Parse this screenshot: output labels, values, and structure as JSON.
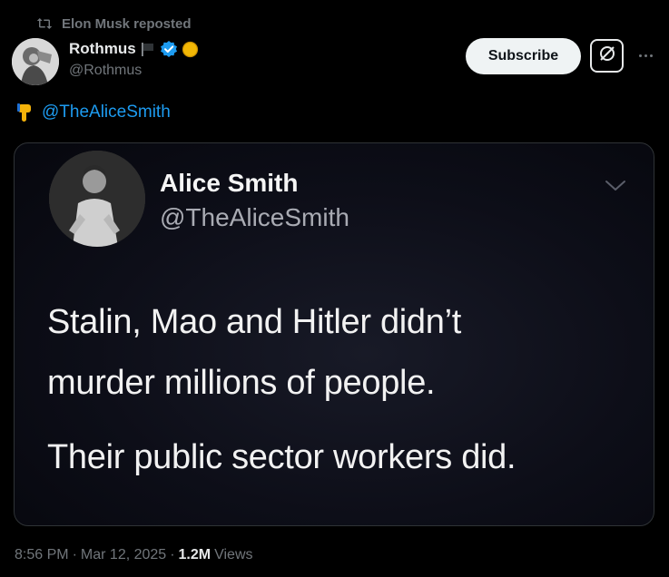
{
  "repost": {
    "label": "Elon Musk reposted",
    "icon": "repost-icon"
  },
  "author": {
    "name": "Rothmus",
    "handle": "@Rothmus",
    "avatar": "author-avatar",
    "badges": [
      "flag-emoji",
      "verified-badge",
      "gold-circle-emoji"
    ],
    "verified_color": "#1d9bf0"
  },
  "actions": {
    "subscribe_label": "Subscribe",
    "grok_icon": "grok-icon",
    "more_icon": "more-icon"
  },
  "tweet": {
    "emoji": "pointing-down-emoji",
    "mention": "@TheAliceSmith"
  },
  "media": {
    "name": "Alice Smith",
    "handle": "@TheAliceSmith",
    "lines": [
      "Stalin, Mao and Hitler didn’t",
      "murder millions of people.",
      "Their public sector workers did."
    ]
  },
  "meta": {
    "time": "8:56 PM",
    "separator": "·",
    "date": "Mar 12, 2025",
    "views_count": "1.2M",
    "views_label": "Views"
  },
  "colors": {
    "background": "#000000",
    "link": "#1d9bf0",
    "muted": "#71767b",
    "text": "#e7e9ea"
  }
}
